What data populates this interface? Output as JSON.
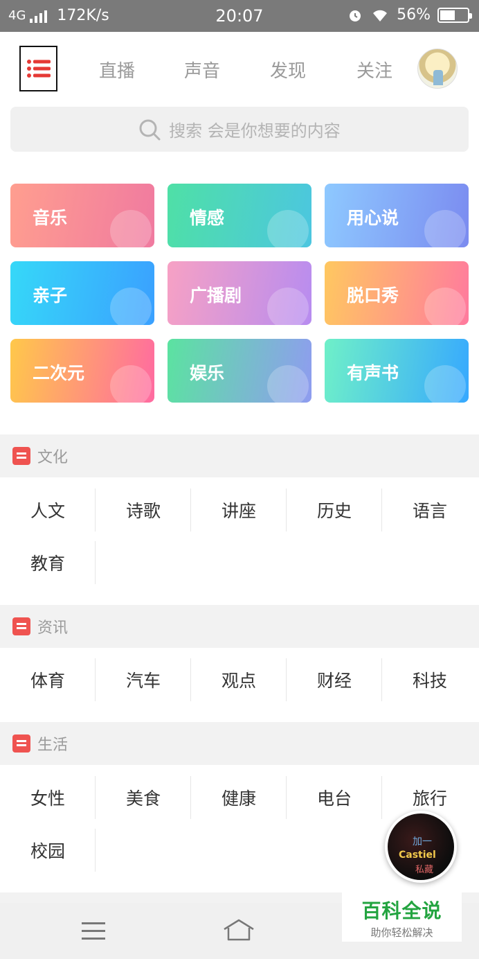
{
  "status_bar": {
    "network": "4G",
    "speed": "172K/s",
    "time": "20:07",
    "battery_text": "56%",
    "battery_level": 0.56
  },
  "header": {
    "tabs": [
      "直播",
      "声音",
      "发现",
      "关注"
    ],
    "menu_icon": "list-icon",
    "avatar": "user-avatar"
  },
  "search": {
    "placeholder": "搜索 会是你想要的内容",
    "icon": "search-icon"
  },
  "categories": [
    {
      "label": "音乐",
      "colors": [
        "#ff9e8f",
        "#f07aa0"
      ],
      "icon": "music-icon"
    },
    {
      "label": "情感",
      "colors": [
        "#4fe0a6",
        "#4cc6e0"
      ],
      "icon": "heart-icon"
    },
    {
      "label": "用心说",
      "colors": [
        "#8ec9ff",
        "#7b8bf0"
      ],
      "icon": "sparkle-icon"
    },
    {
      "label": "亲子",
      "colors": [
        "#36d8f8",
        "#3aa0ff"
      ],
      "icon": "face-icon"
    },
    {
      "label": "广播剧",
      "colors": [
        "#f7a1c4",
        "#b78cf0"
      ],
      "icon": "book-icon"
    },
    {
      "label": "脱口秀",
      "colors": [
        "#ffc860",
        "#ff7a9e"
      ],
      "icon": "smile-icon"
    },
    {
      "label": "二次元",
      "colors": [
        "#ffc84a",
        "#ff6aa1"
      ],
      "icon": "chat-icon"
    },
    {
      "label": "娱乐",
      "colors": [
        "#5be3a0",
        "#8f9cf0"
      ],
      "icon": "gamepad-icon"
    },
    {
      "label": "有声书",
      "colors": [
        "#6ff0c8",
        "#36a8ff"
      ],
      "icon": "location-icon"
    }
  ],
  "sections": [
    {
      "title": "文化",
      "items": [
        "人文",
        "诗歌",
        "讲座",
        "历史",
        "语言",
        "教育"
      ]
    },
    {
      "title": "资讯",
      "items": [
        "体育",
        "汽车",
        "观点",
        "财经",
        "科技"
      ]
    },
    {
      "title": "生活",
      "items": [
        "女性",
        "美食",
        "健康",
        "电台",
        "旅行",
        "校园"
      ]
    }
  ],
  "floating_player": {
    "text": "Castiel",
    "text2": "加一",
    "text3": "私藏"
  },
  "watermark": {
    "title": "百科全说",
    "subtitle": "助你轻松解决"
  }
}
